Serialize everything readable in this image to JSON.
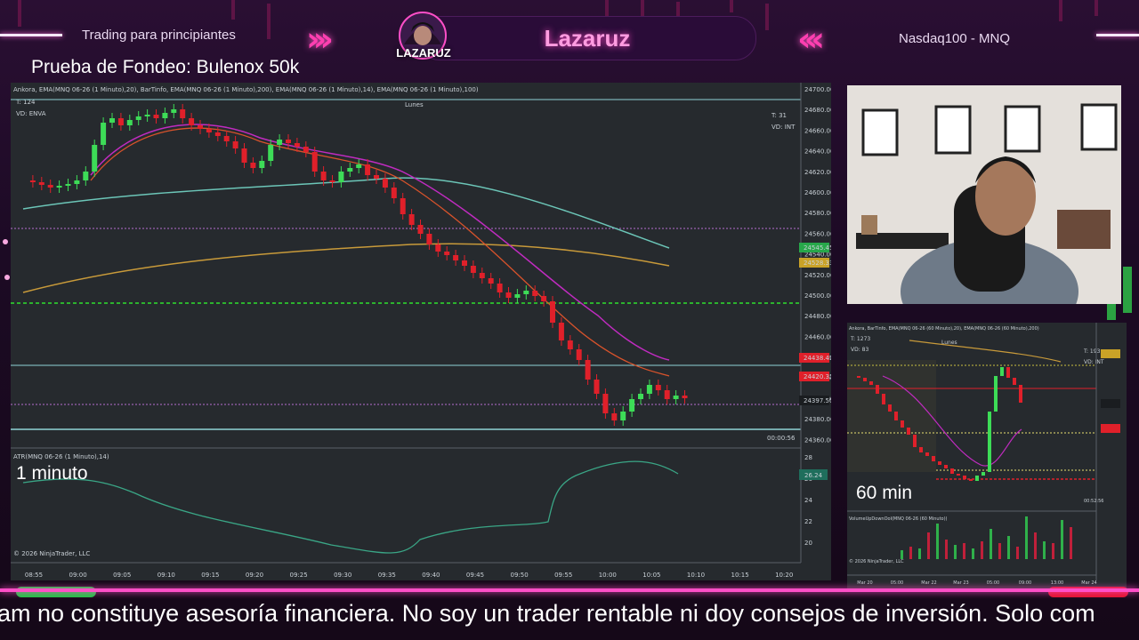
{
  "banner": {
    "left_text": "Trading para principiantes",
    "center_title": "Lazaruz",
    "right_text": "Nasdaq100 - MNQ",
    "logo_text": "LAZARUZ",
    "subtitle": "Prueba de Fondeo: Bulenox 50k"
  },
  "main_chart": {
    "header": "Ankora, EMA(MNQ 06-26 (1 Minuto),20), BarTinfo, EMA(MNQ 06-26 (1 Minuto),200), EMA(MNQ 06-26 (1 Minuto),14), EMA(MNQ 06-26 (1 Minuto),100)",
    "info_t": "T: 124",
    "info_vd": "VD: ENVA",
    "info_t_right": "T: 31",
    "info_vd_right": "VD: INT",
    "day_label": "Lunes",
    "timer": "00:00:56",
    "timeframe_label": "1 minuto",
    "atr_header": "ATR(MNQ 06-26 (1 Minuto),14)",
    "copyright": "© 2026 NinjaTrader, LLC",
    "price_ticks": [
      "24700.00",
      "24680.00",
      "24660.00",
      "24640.00",
      "24620.00",
      "24600.00",
      "24580.00",
      "24560.00",
      "24540.00",
      "24520.00",
      "24500.00",
      "24480.00",
      "24460.00",
      "24440.00",
      "24420.00",
      "24400.00",
      "24380.00",
      "24360.00"
    ],
    "price_tags": [
      {
        "label": "24545.45",
        "color": "#27a84a"
      },
      {
        "label": "24528.33",
        "color": "#c9a227"
      },
      {
        "label": "24438.42",
        "color": "#e0202a"
      },
      {
        "label": "24420.35",
        "color": "#e0202a"
      },
      {
        "label": "24397.50",
        "color": "#1a1d20"
      }
    ],
    "atr_ticks": [
      "28",
      "26",
      "24",
      "22",
      "20"
    ],
    "atr_tag": "26.24",
    "time_ticks": [
      "08:55",
      "09:00",
      "09:05",
      "09:10",
      "09:15",
      "09:20",
      "09:25",
      "09:30",
      "09:35",
      "09:40",
      "09:45",
      "09:50",
      "09:55",
      "10:00",
      "10:05",
      "10:10",
      "10:15",
      "10:20"
    ]
  },
  "small_chart": {
    "header": "Ankora, BarTinfo, EMA(MNQ 06-26 (60 Minuto),20), EMA(MNQ 06-26 (60 Minuto),200)",
    "info_t": "T: 1273",
    "info_vd": "VD: 83",
    "info_t_right": "T: 193",
    "info_vd_right": "VD: INT",
    "day_label": "Lunes",
    "timer": "00:52:56",
    "timeframe_label": "60 min",
    "volume_header": "VolumeUpDownOol(MNQ 06-26 (60 Minuto))",
    "copyright": "© 2026 NinjaTrader, LLC",
    "time_ticks": [
      "Mar 20",
      "05:00",
      "Mar 22",
      "Mar 23",
      "05:00",
      "09:00",
      "13:00",
      "Mar 24"
    ]
  },
  "ticker_text": "am no constituye asesoría financiera. No soy un trader rentable ni doy consejos de inversión. Solo com",
  "colors": {
    "accent": "#ff4fc8",
    "bull": "#3ddc57",
    "bear": "#e0202a",
    "chart_bg": "#262a2e"
  }
}
